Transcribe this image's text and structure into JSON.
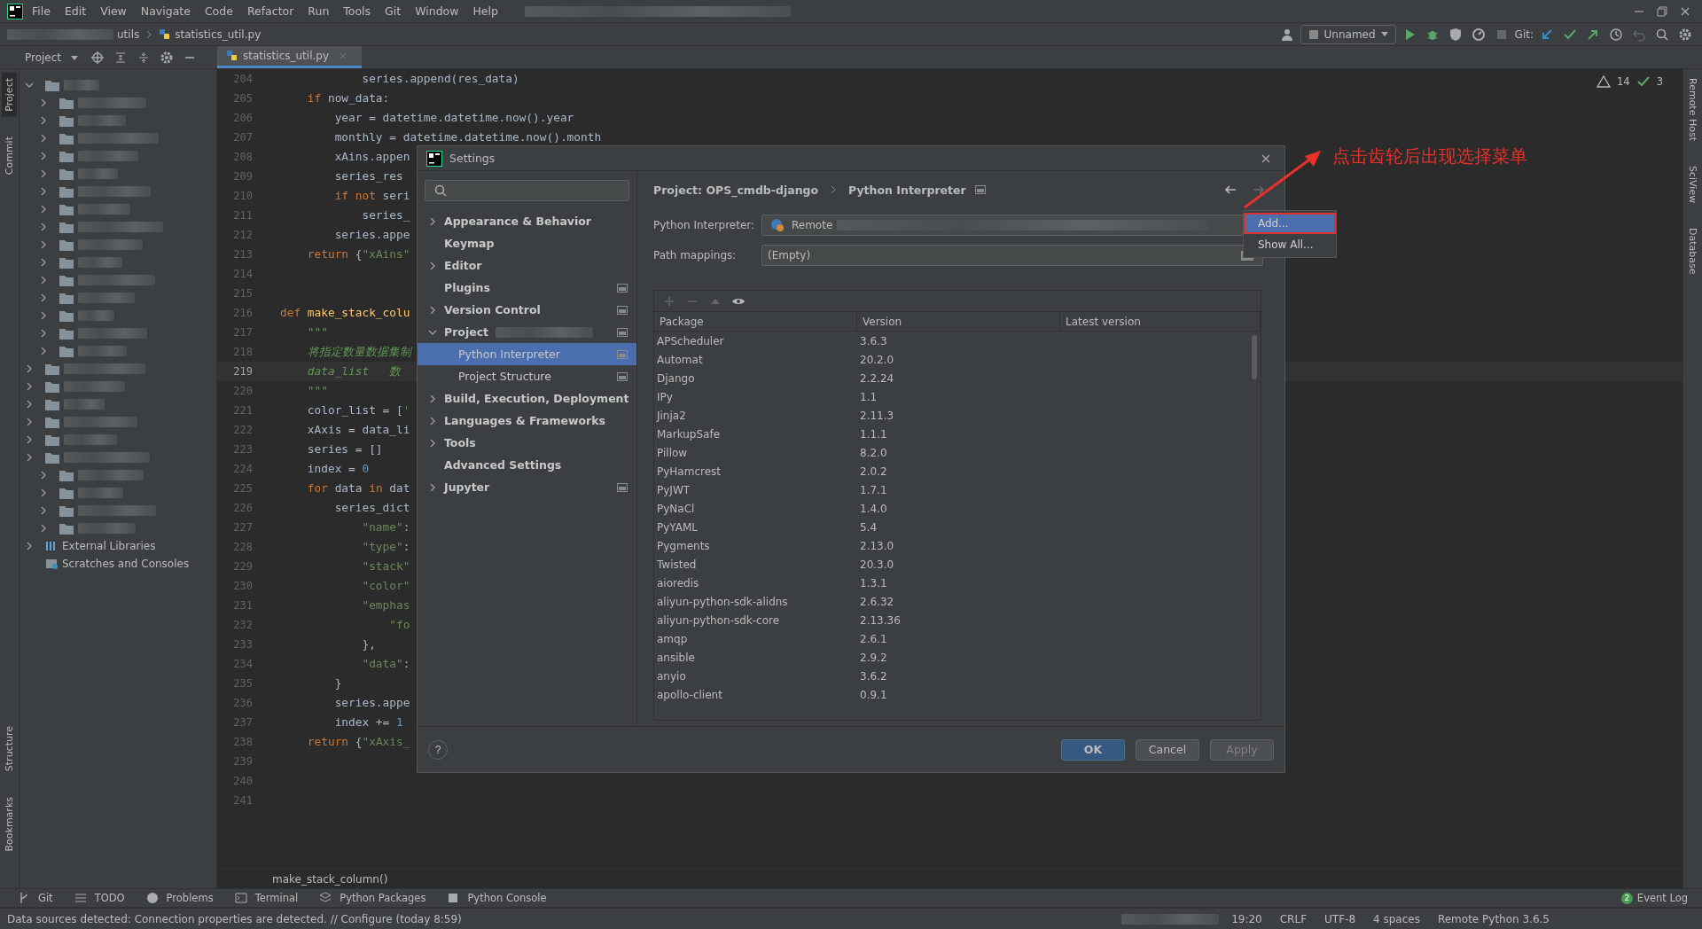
{
  "menu_bar": {
    "items": [
      "File",
      "Edit",
      "View",
      "Navigate",
      "Code",
      "Refactor",
      "Run",
      "Tools",
      "Git",
      "Window",
      "Help"
    ]
  },
  "toolbar": {
    "breadcrumbs": [
      "utils",
      "statistics_util.py"
    ],
    "run_config": "Unnamed",
    "git_label": "Git:"
  },
  "left_stripe": [
    {
      "label": "Project",
      "selected": true
    },
    {
      "label": "Commit",
      "selected": false
    },
    {
      "label": "Structure",
      "selected": false
    },
    {
      "label": "Bookmarks",
      "selected": false
    }
  ],
  "right_stripe": [
    "Remote Host",
    "SciView",
    "Database"
  ],
  "project_panel": {
    "title": "Project",
    "items": [
      {
        "label": "External Libraries",
        "kind": "library"
      },
      {
        "label": "Scratches and Consoles",
        "kind": "scratch"
      }
    ]
  },
  "editor": {
    "tab": "statistics_util.py",
    "warnings": "14",
    "checks": "3",
    "breadcrumb": "make_stack_column()",
    "lines": [
      {
        "n": "204",
        "current": false,
        "tokens": [
          {
            "kind": "plain",
            "text": "            series.append(res_data)"
          }
        ]
      },
      {
        "n": "205",
        "current": false,
        "tokens": [
          {
            "kind": "keyword",
            "text": "    if "
          },
          {
            "kind": "plain",
            "text": "now_data:"
          }
        ]
      },
      {
        "n": "206",
        "current": false,
        "tokens": [
          {
            "kind": "plain",
            "text": "        year = datetime.datetime.now().year"
          }
        ]
      },
      {
        "n": "207",
        "current": false,
        "tokens": [
          {
            "kind": "plain",
            "text": "        monthly = datetime.datetime.now().month"
          }
        ]
      },
      {
        "n": "208",
        "current": false,
        "tokens": [
          {
            "kind": "plain",
            "text": "        xAins.appen"
          }
        ]
      },
      {
        "n": "209",
        "current": false,
        "tokens": [
          {
            "kind": "plain",
            "text": "        series_res"
          }
        ]
      },
      {
        "n": "210",
        "current": false,
        "tokens": [
          {
            "kind": "keyword",
            "text": "        if not "
          },
          {
            "kind": "plain",
            "text": "seri"
          }
        ]
      },
      {
        "n": "211",
        "current": false,
        "tokens": [
          {
            "kind": "plain",
            "text": "            series_"
          }
        ]
      },
      {
        "n": "212",
        "current": false,
        "tokens": [
          {
            "kind": "plain",
            "text": "        series.appe"
          }
        ]
      },
      {
        "n": "213",
        "current": false,
        "tokens": [
          {
            "kind": "keyword",
            "text": "    return "
          },
          {
            "kind": "plain",
            "text": "{"
          },
          {
            "kind": "string",
            "text": "\"xAins\""
          }
        ]
      },
      {
        "n": "214",
        "current": false
      },
      {
        "n": "215",
        "current": false
      },
      {
        "n": "216",
        "current": false,
        "tokens": [
          {
            "kind": "keyword",
            "text": "def "
          },
          {
            "kind": "function",
            "text": "make_stack_colu"
          }
        ]
      },
      {
        "n": "217",
        "current": false,
        "tokens": [
          {
            "kind": "doc",
            "text": "    \"\"\""
          }
        ]
      },
      {
        "n": "218",
        "current": false,
        "tokens": [
          {
            "kind": "doc",
            "text": "    将指定数量数据集制"
          }
        ]
      },
      {
        "n": "219",
        "current": true,
        "tokens": [
          {
            "kind": "doc",
            "text": "    data_list   数"
          }
        ]
      },
      {
        "n": "220",
        "current": false,
        "tokens": [
          {
            "kind": "doc",
            "text": "    \"\"\""
          }
        ]
      },
      {
        "n": "221",
        "current": false,
        "tokens": [
          {
            "kind": "plain",
            "text": "    color_list = ["
          },
          {
            "kind": "string",
            "text": "'"
          }
        ]
      },
      {
        "n": "222",
        "current": false,
        "tokens": [
          {
            "kind": "plain",
            "text": "    xAxis = data_li"
          }
        ]
      },
      {
        "n": "223",
        "current": false,
        "tokens": [
          {
            "kind": "plain",
            "text": "    series = []"
          }
        ]
      },
      {
        "n": "224",
        "current": false,
        "tokens": [
          {
            "kind": "plain",
            "text": "    index = "
          },
          {
            "kind": "number",
            "text": "0"
          }
        ]
      },
      {
        "n": "225",
        "current": false,
        "tokens": [
          {
            "kind": "keyword",
            "text": "    for "
          },
          {
            "kind": "plain",
            "text": "data "
          },
          {
            "kind": "keyword",
            "text": "in "
          },
          {
            "kind": "plain",
            "text": "dat"
          }
        ]
      },
      {
        "n": "226",
        "current": false,
        "tokens": [
          {
            "kind": "plain",
            "text": "        series_dict"
          }
        ]
      },
      {
        "n": "227",
        "current": false,
        "tokens": [
          {
            "kind": "string",
            "text": "            \"name\""
          },
          {
            "kind": "plain",
            "text": ":"
          }
        ]
      },
      {
        "n": "228",
        "current": false,
        "tokens": [
          {
            "kind": "string",
            "text": "            \"type\""
          },
          {
            "kind": "plain",
            "text": ":"
          }
        ]
      },
      {
        "n": "229",
        "current": false,
        "tokens": [
          {
            "kind": "string",
            "text": "            \"stack\""
          }
        ]
      },
      {
        "n": "230",
        "current": false,
        "tokens": [
          {
            "kind": "string",
            "text": "            \"color\""
          }
        ]
      },
      {
        "n": "231",
        "current": false,
        "tokens": [
          {
            "kind": "string",
            "text": "            \"emphas"
          }
        ]
      },
      {
        "n": "232",
        "current": false,
        "tokens": [
          {
            "kind": "string",
            "text": "                \"fo"
          }
        ]
      },
      {
        "n": "233",
        "current": false,
        "tokens": [
          {
            "kind": "plain",
            "text": "            },"
          }
        ]
      },
      {
        "n": "234",
        "current": false,
        "tokens": [
          {
            "kind": "string",
            "text": "            \"data\""
          },
          {
            "kind": "plain",
            "text": ":"
          }
        ]
      },
      {
        "n": "235",
        "current": false,
        "tokens": [
          {
            "kind": "plain",
            "text": "        }"
          }
        ]
      },
      {
        "n": "236",
        "current": false,
        "tokens": [
          {
            "kind": "plain",
            "text": "        series.appe"
          }
        ]
      },
      {
        "n": "237",
        "current": false,
        "tokens": [
          {
            "kind": "plain",
            "text": "        index += "
          },
          {
            "kind": "number",
            "text": "1"
          }
        ]
      },
      {
        "n": "238",
        "current": false,
        "tokens": [
          {
            "kind": "keyword",
            "text": "    return "
          },
          {
            "kind": "plain",
            "text": "{"
          },
          {
            "kind": "string",
            "text": "\"xAxis_"
          }
        ]
      },
      {
        "n": "239",
        "current": false
      },
      {
        "n": "240",
        "current": false
      },
      {
        "n": "241",
        "current": false
      }
    ]
  },
  "dialog": {
    "title": "Settings",
    "help": "?",
    "nav": [
      {
        "label": "Appearance & Behavior",
        "expandable": true,
        "expanded": false,
        "selected": false,
        "project_level": false
      },
      {
        "label": "Keymap",
        "expandable": false,
        "selected": false,
        "project_level": false
      },
      {
        "label": "Editor",
        "expandable": true,
        "expanded": false,
        "selected": false,
        "project_level": false
      },
      {
        "label": "Plugins",
        "expandable": false,
        "selected": false,
        "project_level": true
      },
      {
        "label": "Version Control",
        "expandable": true,
        "expanded": false,
        "selected": false,
        "project_level": true
      },
      {
        "label": "Project",
        "expandable": true,
        "expanded": true,
        "selected": false,
        "project_level": true,
        "children": [
          {
            "label": "Python Interpreter",
            "selected": true,
            "project_level": true
          },
          {
            "label": "Project Structure",
            "selected": false,
            "project_level": true
          }
        ]
      },
      {
        "label": "Build, Execution, Deployment",
        "expandable": true,
        "expanded": false,
        "selected": false,
        "project_level": false
      },
      {
        "label": "Languages & Frameworks",
        "expandable": true,
        "expanded": false,
        "selected": false,
        "project_level": false
      },
      {
        "label": "Tools",
        "expandable": true,
        "expanded": false,
        "selected": false,
        "project_level": false
      },
      {
        "label": "Advanced Settings",
        "expandable": false,
        "selected": false,
        "project_level": false
      },
      {
        "label": "Jupyter",
        "expandable": true,
        "expanded": false,
        "selected": false,
        "project_level": true
      }
    ],
    "breadcrumb": [
      "Project: OPS_cmdb-django",
      "Python Interpreter"
    ],
    "interpreter_label": "Python Interpreter:",
    "interpreter_value": "Remote",
    "path_label": "Path mappings:",
    "path_value": "(Empty)",
    "columns": [
      "Package",
      "Version",
      "Latest version"
    ],
    "packages": [
      {
        "name": "APScheduler",
        "version": "3.6.3"
      },
      {
        "name": "Automat",
        "version": "20.2.0"
      },
      {
        "name": "Django",
        "version": "2.2.24"
      },
      {
        "name": "IPy",
        "version": "1.1"
      },
      {
        "name": "Jinja2",
        "version": "2.11.3"
      },
      {
        "name": "MarkupSafe",
        "version": "1.1.1"
      },
      {
        "name": "Pillow",
        "version": "8.2.0"
      },
      {
        "name": "PyHamcrest",
        "version": "2.0.2"
      },
      {
        "name": "PyJWT",
        "version": "1.7.1"
      },
      {
        "name": "PyNaCl",
        "version": "1.4.0"
      },
      {
        "name": "PyYAML",
        "version": "5.4"
      },
      {
        "name": "Pygments",
        "version": "2.13.0"
      },
      {
        "name": "Twisted",
        "version": "20.3.0"
      },
      {
        "name": "aioredis",
        "version": "1.3.1"
      },
      {
        "name": "aliyun-python-sdk-alidns",
        "version": "2.6.32"
      },
      {
        "name": "aliyun-python-sdk-core",
        "version": "2.13.36"
      },
      {
        "name": "amqp",
        "version": "2.6.1"
      },
      {
        "name": "ansible",
        "version": "2.9.2"
      },
      {
        "name": "anyio",
        "version": "3.6.2"
      },
      {
        "name": "apollo-client",
        "version": "0.9.1"
      }
    ],
    "buttons": [
      {
        "label": "OK",
        "kind": "primary"
      },
      {
        "label": "Cancel",
        "kind": "default"
      },
      {
        "label": "Apply",
        "kind": "disabled"
      }
    ]
  },
  "popup_menu": {
    "items": [
      {
        "label": "Add...",
        "selected": true
      },
      {
        "label": "Show All...",
        "selected": false
      }
    ]
  },
  "annotation": {
    "text": "点击齿轮后出现选择菜单"
  },
  "tool_tabs": [
    "Git",
    "TODO",
    "Problems",
    "Terminal",
    "Python Packages",
    "Python Console"
  ],
  "event_log": {
    "label": "Event Log",
    "count": "2"
  },
  "status_bar": {
    "message": "Data sources detected: Connection properties are detected. // Configure (today 8:59)",
    "items": [
      "19:20",
      "CRLF",
      "UTF-8",
      "4 spaces",
      "Remote Python 3.6.5"
    ]
  }
}
